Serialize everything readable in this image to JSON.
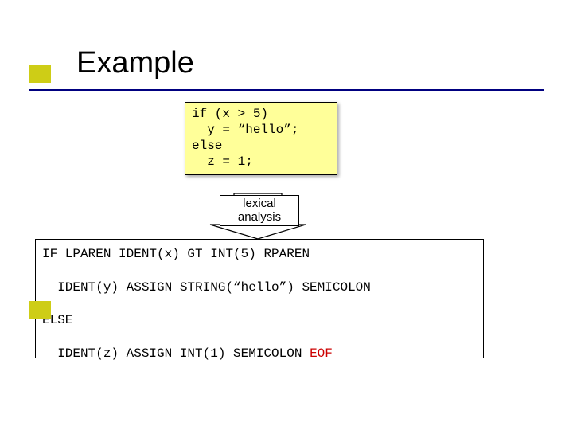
{
  "title": "Example",
  "code": {
    "l1": "if (x > 5)",
    "l2": "  y = “hello”;",
    "l3": "else",
    "l4": "  z = 1;"
  },
  "arrow": {
    "line1": "lexical",
    "line2": "analysis"
  },
  "tokens": {
    "line1": "IF LPAREN IDENT(x) GT INT(5) RPAREN",
    "line2": "  IDENT(y) ASSIGN STRING(“hello”) SEMICOLON",
    "line3": "ELSE",
    "line4_a": "  IDENT(z) ASSIGN INT(1) SEMICOLON ",
    "line4_eof": "EOF"
  }
}
